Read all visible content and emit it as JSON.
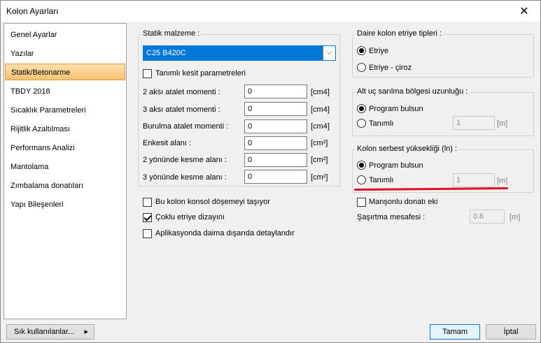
{
  "window": {
    "title": "Kolon Ayarları",
    "close_glyph": "✕"
  },
  "sidebar": {
    "items": [
      {
        "label": "Genel Ayarlar"
      },
      {
        "label": "Yazılar"
      },
      {
        "label": "Statik/Betonarme",
        "active": true
      },
      {
        "label": "TBDY 2018"
      },
      {
        "label": "Sıcaklık Parametreleri"
      },
      {
        "label": "Rijitlik Azaltılması"
      },
      {
        "label": "Performans Analizi"
      },
      {
        "label": "Mantolama"
      },
      {
        "label": "Zımbalama donatıları"
      },
      {
        "label": "Yapı Bileşenleri"
      }
    ]
  },
  "statik": {
    "group_title": "Statik malzeme :",
    "material_select": "C25 B420C",
    "tanimli_kesit": "Tanımlı kesit parametreleri",
    "rows": [
      {
        "label": "2 aksı atalet momenti :",
        "value": "0",
        "unit": "[cm4]"
      },
      {
        "label": "3 aksı atalet momenti :",
        "value": "0",
        "unit": "[cm4]"
      },
      {
        "label": "Burulma atalet momenti :",
        "value": "0",
        "unit": "[cm4]"
      },
      {
        "label": "Enkesit alanı :",
        "value": "0",
        "unit": "[cm²]"
      },
      {
        "label": "2 yönünde kesme alanı :",
        "value": "0",
        "unit": "[cm²]"
      },
      {
        "label": "3 yönünde kesme alanı :",
        "value": "0",
        "unit": "[cm²]"
      }
    ]
  },
  "options": {
    "konsol": "Bu kolon konsol döşemeyi taşıyor",
    "coklu": "Çoklu etriye dizayını",
    "aplikasyon": "Aplikasyonda daima dışarıda detaylandır"
  },
  "daire": {
    "title": "Daire kolon etriye tipleri :",
    "opt1": "Etriye",
    "opt2": "Etriye - çiroz"
  },
  "altuc": {
    "title": "Alt uç sarılma bölgesi uzunluğu :",
    "opt1": "Program bulsun",
    "opt2": "Tanımlı",
    "value": "1",
    "unit": "[m]"
  },
  "serbest": {
    "title": "Kolon serbest yüksekliği (ln) :",
    "opt1": "Program bulsun",
    "opt2": "Tanımlı",
    "value": "1",
    "unit": "[m]"
  },
  "manson": "Manşonlu donatı eki",
  "sasirtma": {
    "label": "Şaşırtma mesafesi :",
    "value": "0.6",
    "unit": "[m]"
  },
  "footer": {
    "favorites": "Sık kullanılanlar...",
    "favorites_arrow": "▸",
    "ok": "Tamam",
    "cancel": "İptal"
  }
}
